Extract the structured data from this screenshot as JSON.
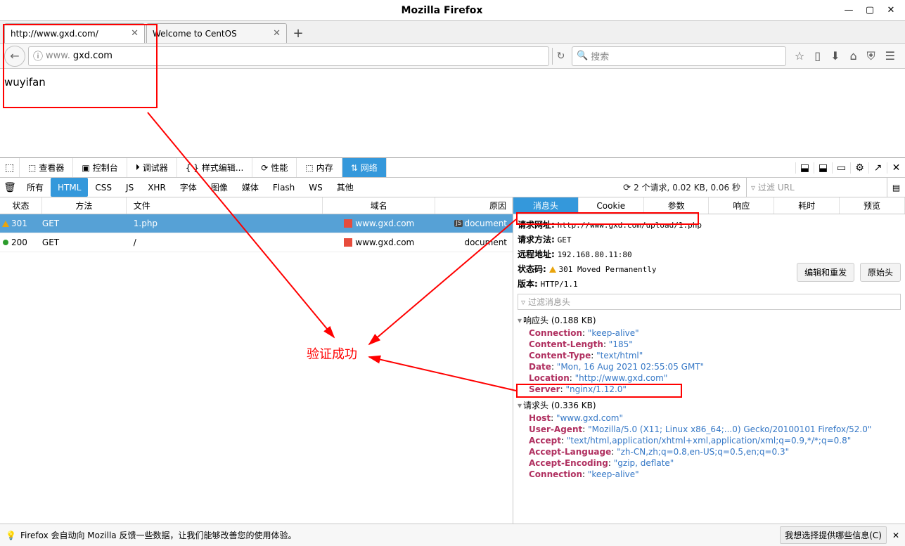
{
  "window": {
    "title": "Mozilla Firefox"
  },
  "tabs": [
    {
      "label": "http://www.gxd.com/"
    },
    {
      "label": "Welcome to CentOS"
    }
  ],
  "urlbar": {
    "prefix": "www.",
    "domain": "gxd.com",
    "search_placeholder": "搜索"
  },
  "page": {
    "body_text": "wuyifan"
  },
  "devtools": {
    "tabs": {
      "inspector": "查看器",
      "console": "控制台",
      "debugger": "调试器",
      "style": "样式编辑...",
      "perf": "性能",
      "memory": "内存",
      "network": "网络"
    }
  },
  "network": {
    "filters": {
      "all": "所有",
      "html": "HTML",
      "css": "CSS",
      "js": "JS",
      "xhr": "XHR",
      "fonts": "字体",
      "images": "图像",
      "media": "媒体",
      "flash": "Flash",
      "ws": "WS",
      "other": "其他"
    },
    "summary": "2 个请求, 0.02 KB, 0.06 秒",
    "filter_placeholder": "过滤 URL",
    "columns": {
      "status": "状态",
      "method": "方法",
      "file": "文件",
      "domain": "域名",
      "cause": "原因"
    },
    "rows": [
      {
        "status": "301",
        "method": "GET",
        "file": "1.php",
        "domain": "www.gxd.com",
        "cause": "document",
        "jsbadge": true,
        "warn": true
      },
      {
        "status": "200",
        "method": "GET",
        "file": "/",
        "domain": "www.gxd.com",
        "cause": "document",
        "jsbadge": false,
        "warn": false
      }
    ]
  },
  "detail": {
    "tabs": {
      "headers": "消息头",
      "cookie": "Cookie",
      "params": "参数",
      "response": "响应",
      "timing": "耗时",
      "preview": "预览"
    },
    "labels": {
      "url": "请求网址:",
      "method": "请求方法:",
      "remote": "远程地址:",
      "status": "状态码:",
      "version": "版本:",
      "edit_resend": "编辑和重发",
      "raw": "原始头",
      "filter": "过滤消息头",
      "resp_hdr": "响应头",
      "req_hdr": "请求头"
    },
    "values": {
      "url": "http://www.gxd.com/upload/1.php",
      "method": "GET",
      "remote": "192.168.80.11:80",
      "status": "301 Moved Permanently",
      "version": "HTTP/1.1",
      "resp_size": "(0.188 KB)",
      "req_size": "(0.336 KB)"
    },
    "response_headers": [
      {
        "k": "Connection",
        "v": "\"keep-alive\""
      },
      {
        "k": "Content-Length",
        "v": "\"185\""
      },
      {
        "k": "Content-Type",
        "v": "\"text/html\""
      },
      {
        "k": "Date",
        "v": "\"Mon, 16 Aug 2021 02:55:05 GMT\""
      },
      {
        "k": "Location",
        "v": "\"http://www.gxd.com\""
      },
      {
        "k": "Server",
        "v": "\"nginx/1.12.0\""
      }
    ],
    "request_headers": [
      {
        "k": "Host",
        "v": "\"www.gxd.com\""
      },
      {
        "k": "User-Agent",
        "v": "\"Mozilla/5.0 (X11; Linux x86_64;...0) Gecko/20100101 Firefox/52.0\""
      },
      {
        "k": "Accept",
        "v": "\"text/html,application/xhtml+xml,application/xml;q=0.9,*/*;q=0.8\""
      },
      {
        "k": "Accept-Language",
        "v": "\"zh-CN,zh;q=0.8,en-US;q=0.5,en;q=0.3\""
      },
      {
        "k": "Accept-Encoding",
        "v": "\"gzip, deflate\""
      },
      {
        "k": "Connection",
        "v": "\"keep-alive\""
      }
    ]
  },
  "statusbar": {
    "text": "Firefox 会自动向 Mozilla 反馈一些数据，让我们能够改善您的使用体验。",
    "choose": "我想选择提供哪些信息(C)"
  },
  "annotation": {
    "success": "验证成功"
  }
}
